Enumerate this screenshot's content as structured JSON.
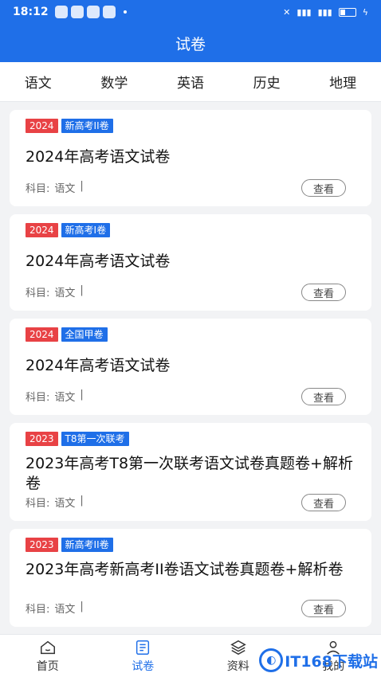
{
  "statusbar": {
    "time": "18:12"
  },
  "header": {
    "title": "试卷"
  },
  "tabs": [
    {
      "label": "语文",
      "active": true
    },
    {
      "label": "数学",
      "active": false
    },
    {
      "label": "英语",
      "active": false
    },
    {
      "label": "历史",
      "active": false
    },
    {
      "label": "地理",
      "active": false
    }
  ],
  "papers": [
    {
      "year": "2024",
      "kind": "新高考II卷",
      "title": "2024年高考语文试卷",
      "subject_label": "科目:",
      "subject": "语文",
      "sep": "|",
      "view": "查看"
    },
    {
      "year": "2024",
      "kind": "新高考I卷",
      "title": "2024年高考语文试卷",
      "subject_label": "科目:",
      "subject": "语文",
      "sep": "|",
      "view": "查看"
    },
    {
      "year": "2024",
      "kind": "全国甲卷",
      "title": "2024年高考语文试卷",
      "subject_label": "科目:",
      "subject": "语文",
      "sep": "|",
      "view": "查看"
    },
    {
      "year": "2023",
      "kind": "T8第一次联考",
      "title": "2023年高考T8第一次联考语文试卷真题卷+解析卷",
      "subject_label": "科目:",
      "subject": "语文",
      "sep": "|",
      "view": "查看"
    },
    {
      "year": "2023",
      "kind": "新高考II卷",
      "title": "2023年高考新高考II卷语文试卷真题卷+解析卷",
      "subject_label": "科目:",
      "subject": "语文",
      "sep": "|",
      "view": "查看"
    }
  ],
  "bottom_nav": [
    {
      "label": "首页",
      "icon": "home-icon",
      "active": false
    },
    {
      "label": "试卷",
      "icon": "paper-icon",
      "active": true
    },
    {
      "label": "资料",
      "icon": "layers-icon",
      "active": false
    },
    {
      "label": "我的",
      "icon": "user-icon",
      "active": false
    }
  ],
  "watermark": {
    "text": "IT168下载站"
  },
  "colors": {
    "primary": "#1f6fe8",
    "year_tag": "#e84245"
  }
}
